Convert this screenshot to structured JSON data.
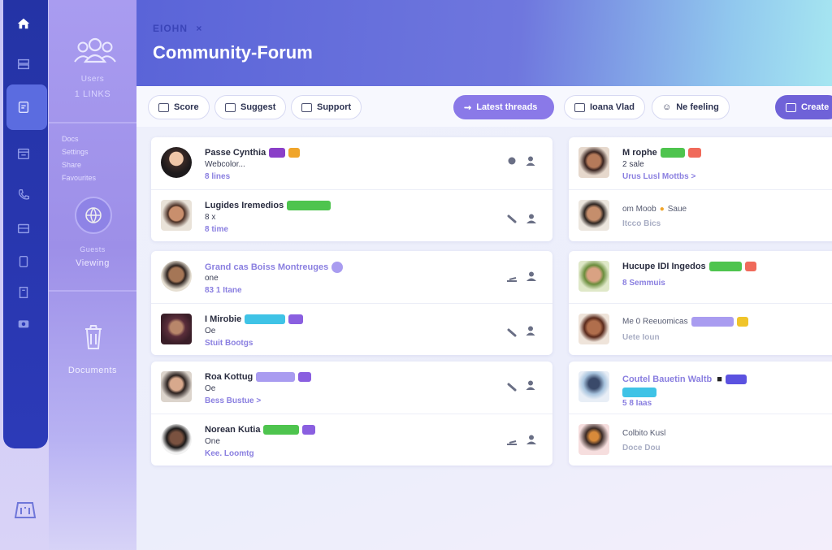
{
  "rail": {
    "icons": [
      "home-icon",
      "grid-icon",
      "document-icon",
      "calendar-icon",
      "phone-icon",
      "inbox-icon",
      "tablet-icon",
      "book-icon",
      "camera-icon",
      "folder-icon"
    ]
  },
  "sidebar": {
    "group_label": "Users",
    "group_sub": "1 LINKS",
    "links": [
      "Docs",
      "Settings",
      "Share",
      "Favourites"
    ],
    "circle_label": "Guests",
    "circle_sub": "Viewing",
    "trash_label": "Documents"
  },
  "header": {
    "breadcrumb": "EIOHN",
    "breadcrumb_close": "×",
    "title": "Community-Forum"
  },
  "toolbar": {
    "filters": [
      "Score",
      "Suggest",
      "Support"
    ],
    "primary": "Latest threads",
    "sort": [
      "Ioana Vlad",
      "Ne feeling"
    ],
    "new": "Create"
  },
  "colors": {
    "accent": "#6f62d8",
    "green": "#4ec44e",
    "cyan": "#3fc3e6",
    "violet": "#a99cf0",
    "orange": "#f0a52a",
    "red": "#f06a5a"
  },
  "left_cards": [
    {
      "rows": [
        {
          "title": "Passe Cynthia",
          "sub": "Webcolor...",
          "meta": "8 lines"
        },
        {
          "title": "Lugides Iremedios",
          "sub": "8 x",
          "meta": "8 time"
        }
      ]
    },
    {
      "rows": [
        {
          "title": "Grand cas Boiss Montreuges",
          "sub": "one",
          "meta": "83 1 Itane"
        },
        {
          "title": "I Mirobie",
          "sub": "Oe",
          "meta": "Stuit Bootgs"
        }
      ]
    },
    {
      "rows": [
        {
          "title": "Roa Kottug",
          "sub": "Oe",
          "meta": "Bess Bustue >"
        },
        {
          "title": "Norean Kutia",
          "sub": "One",
          "meta": "Kee. Loomtg"
        }
      ]
    }
  ],
  "right_cards": [
    {
      "rows": [
        {
          "title": "M rophe",
          "sub": "2 sale",
          "meta": "Urus Lusl Mottbs >"
        },
        {
          "title": "om Moob",
          "sub": "Saue",
          "meta": "Itcco Bics"
        }
      ]
    },
    {
      "rows": [
        {
          "title": "Hucupe IDI Ingedos",
          "sub": "",
          "meta": "8 Semmuis"
        },
        {
          "title": "Me 0 Reeuomicas",
          "sub": "",
          "meta": "Uete Ioun"
        }
      ]
    },
    {
      "rows": [
        {
          "title": "Coutel Bauetin Waltb",
          "sub": "",
          "meta": "5 8 Iaas"
        },
        {
          "title": "Colbito Kusl",
          "sub": "",
          "meta": "Doce Dou"
        }
      ]
    }
  ]
}
